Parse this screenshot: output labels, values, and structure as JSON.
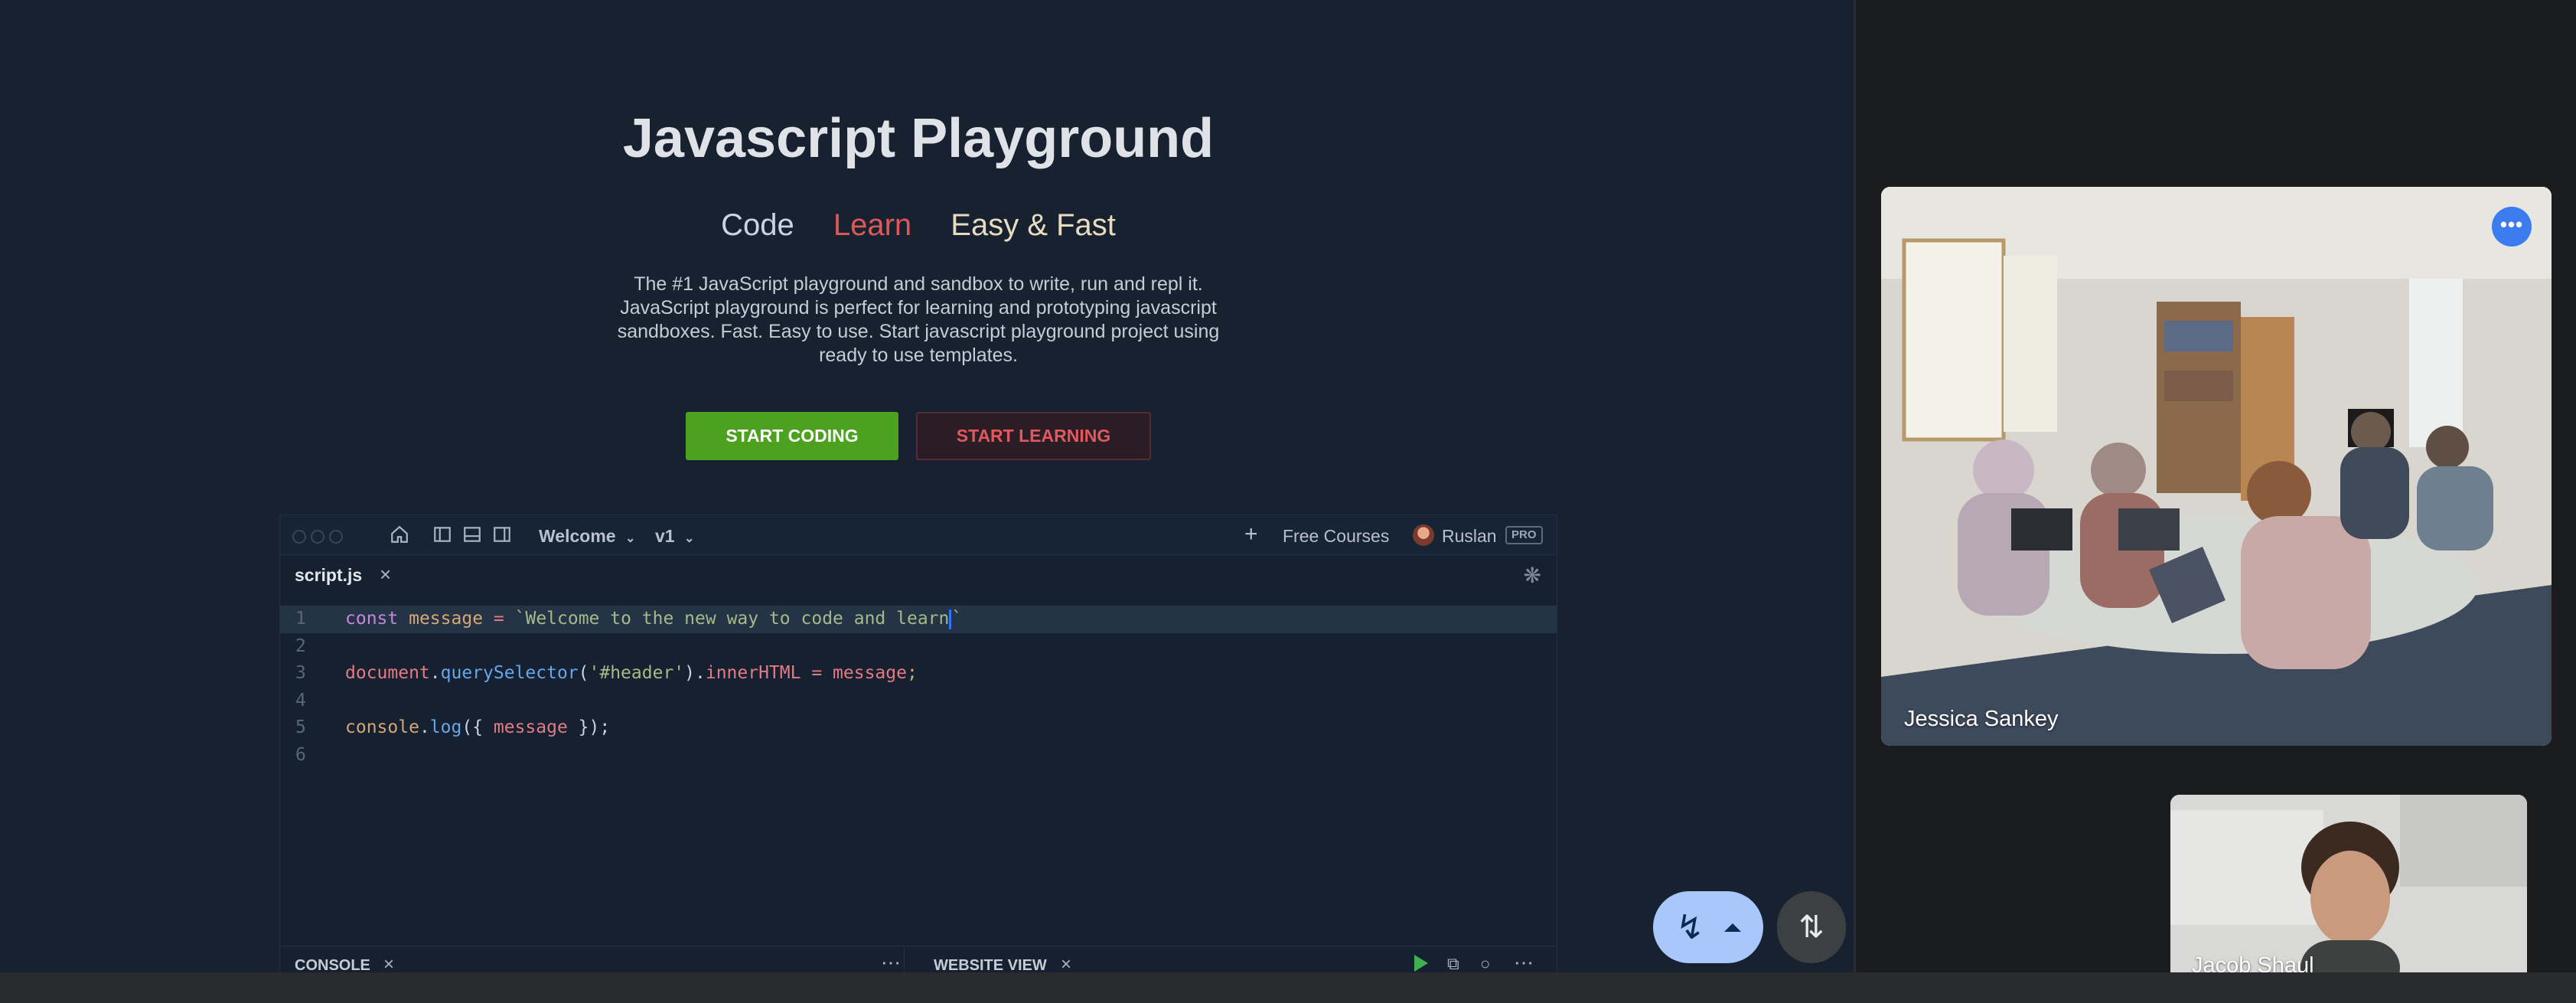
{
  "playground": {
    "title": "Javascript Playground",
    "tags": [
      "Code",
      "Learn",
      "Easy & Fast"
    ],
    "description": "The #1 JavaScript playground and sandbox to write, run and repl it. JavaScript playground is perfect for learning and prototyping javascript sandboxes. Fast. Easy to use. Start javascript playground project using ready to use templates.",
    "start_coding": "START CODING",
    "start_learning": "START LEARNING",
    "colors": {
      "accent_green": "#4ca11f",
      "accent_red": "#e2585c",
      "background": "#172130"
    }
  },
  "editor": {
    "toolbar": {
      "home_icon": "home-icon",
      "layout_icons": [
        "sidebar-left-icon",
        "panel-bottom-icon",
        "sidebar-right-icon"
      ],
      "welcome": "Welcome",
      "version": "v1",
      "add_icon": "plus-icon",
      "free_courses": "Free Courses",
      "user": "Ruslan",
      "badge": "PRO"
    },
    "file_tab": {
      "name": "script.js"
    },
    "code_lines": [
      {
        "number": "1",
        "text": "const message = `Welcome to the new way to code and learn`"
      },
      {
        "number": "2",
        "text": ""
      },
      {
        "number": "3",
        "text": "document.querySelector('#header').innerHTML = message;"
      },
      {
        "number": "4",
        "text": ""
      },
      {
        "number": "5",
        "text": "console.log({ message });"
      },
      {
        "number": "6",
        "text": ""
      }
    ],
    "panels": {
      "console": "CONSOLE",
      "website_view": "WEBSITE VIEW"
    }
  },
  "meeting": {
    "participants": [
      {
        "name": "Jessica Sankey"
      },
      {
        "name": "Jacob Shaul"
      }
    ],
    "controls": {
      "more_icon": "more-horiz-icon",
      "reactions_icon": "bolt-icon",
      "move_icon": "swap-vertical-icon"
    }
  }
}
